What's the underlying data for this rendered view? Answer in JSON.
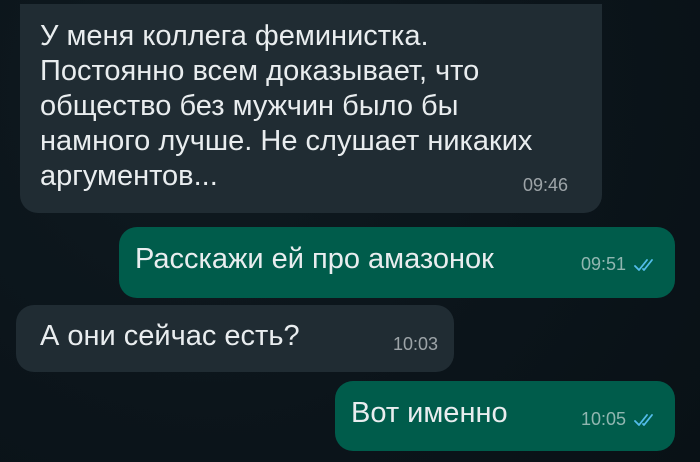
{
  "colors": {
    "background": "#0b141a",
    "incoming_bubble": "#202c33",
    "outgoing_bubble": "#005c4b",
    "text": "#e9edef",
    "read_check": "#53bdeb"
  },
  "messages": [
    {
      "direction": "incoming",
      "text": "У меня коллега феминистка.\nПостоянно всем доказывает, что\nобщество без мужчин было бы\nнамного лучше. Не слушает никаких\nаргументов...",
      "time": "09:46",
      "status": ""
    },
    {
      "direction": "outgoing",
      "text": "Расскажи ей про амазонок",
      "time": "09:51",
      "status": "read-double-check-icon"
    },
    {
      "direction": "incoming",
      "text": "А они сейчас есть?",
      "time": "10:03",
      "status": ""
    },
    {
      "direction": "outgoing",
      "text": "Вот именно",
      "time": "10:05",
      "status": "read-double-check-icon"
    }
  ]
}
